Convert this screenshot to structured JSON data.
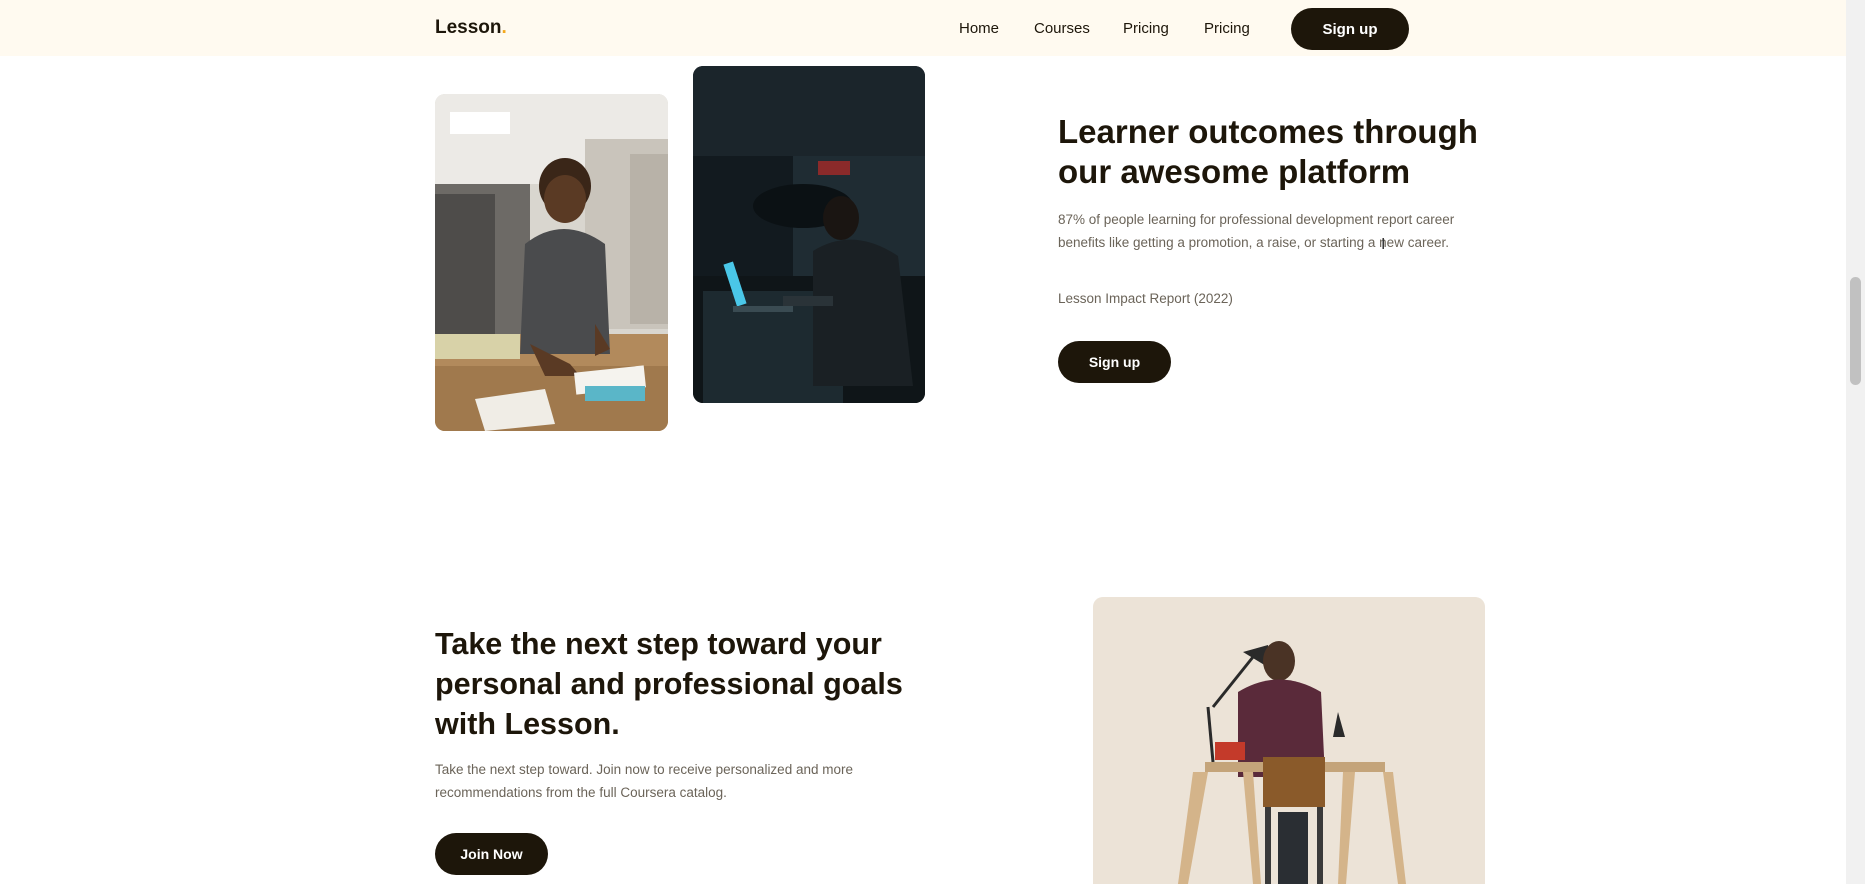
{
  "navbar": {
    "logo_text": "Lesson",
    "logo_dot": ".",
    "links": [
      "Home",
      "Courses",
      "Pricing",
      "Pricing"
    ],
    "signup_label": "Sign up"
  },
  "outcomes": {
    "title": "Learner outcomes through our awesome platform",
    "body": "87% of people learning for professional development report career benefits like getting a promotion, a raise, or starting a new career.",
    "citation": "Lesson Impact Report (2022)",
    "signup_label": "Sign up",
    "images": [
      "student-writing-photo",
      "student-laptop-dark-photo"
    ]
  },
  "next_step": {
    "title": "Take the next step toward your personal and professional goals with Lesson.",
    "body": "Take the next step toward. Join now to receive personalized and more recommendations from the full Coursera catalog.",
    "join_label": "Join Now",
    "image": "man-at-desk-photo"
  },
  "colors": {
    "nav_bg": "#fffaf0",
    "primary_dark": "#1d160a",
    "accent": "#f4a81d",
    "body_text": "#6b6459"
  }
}
